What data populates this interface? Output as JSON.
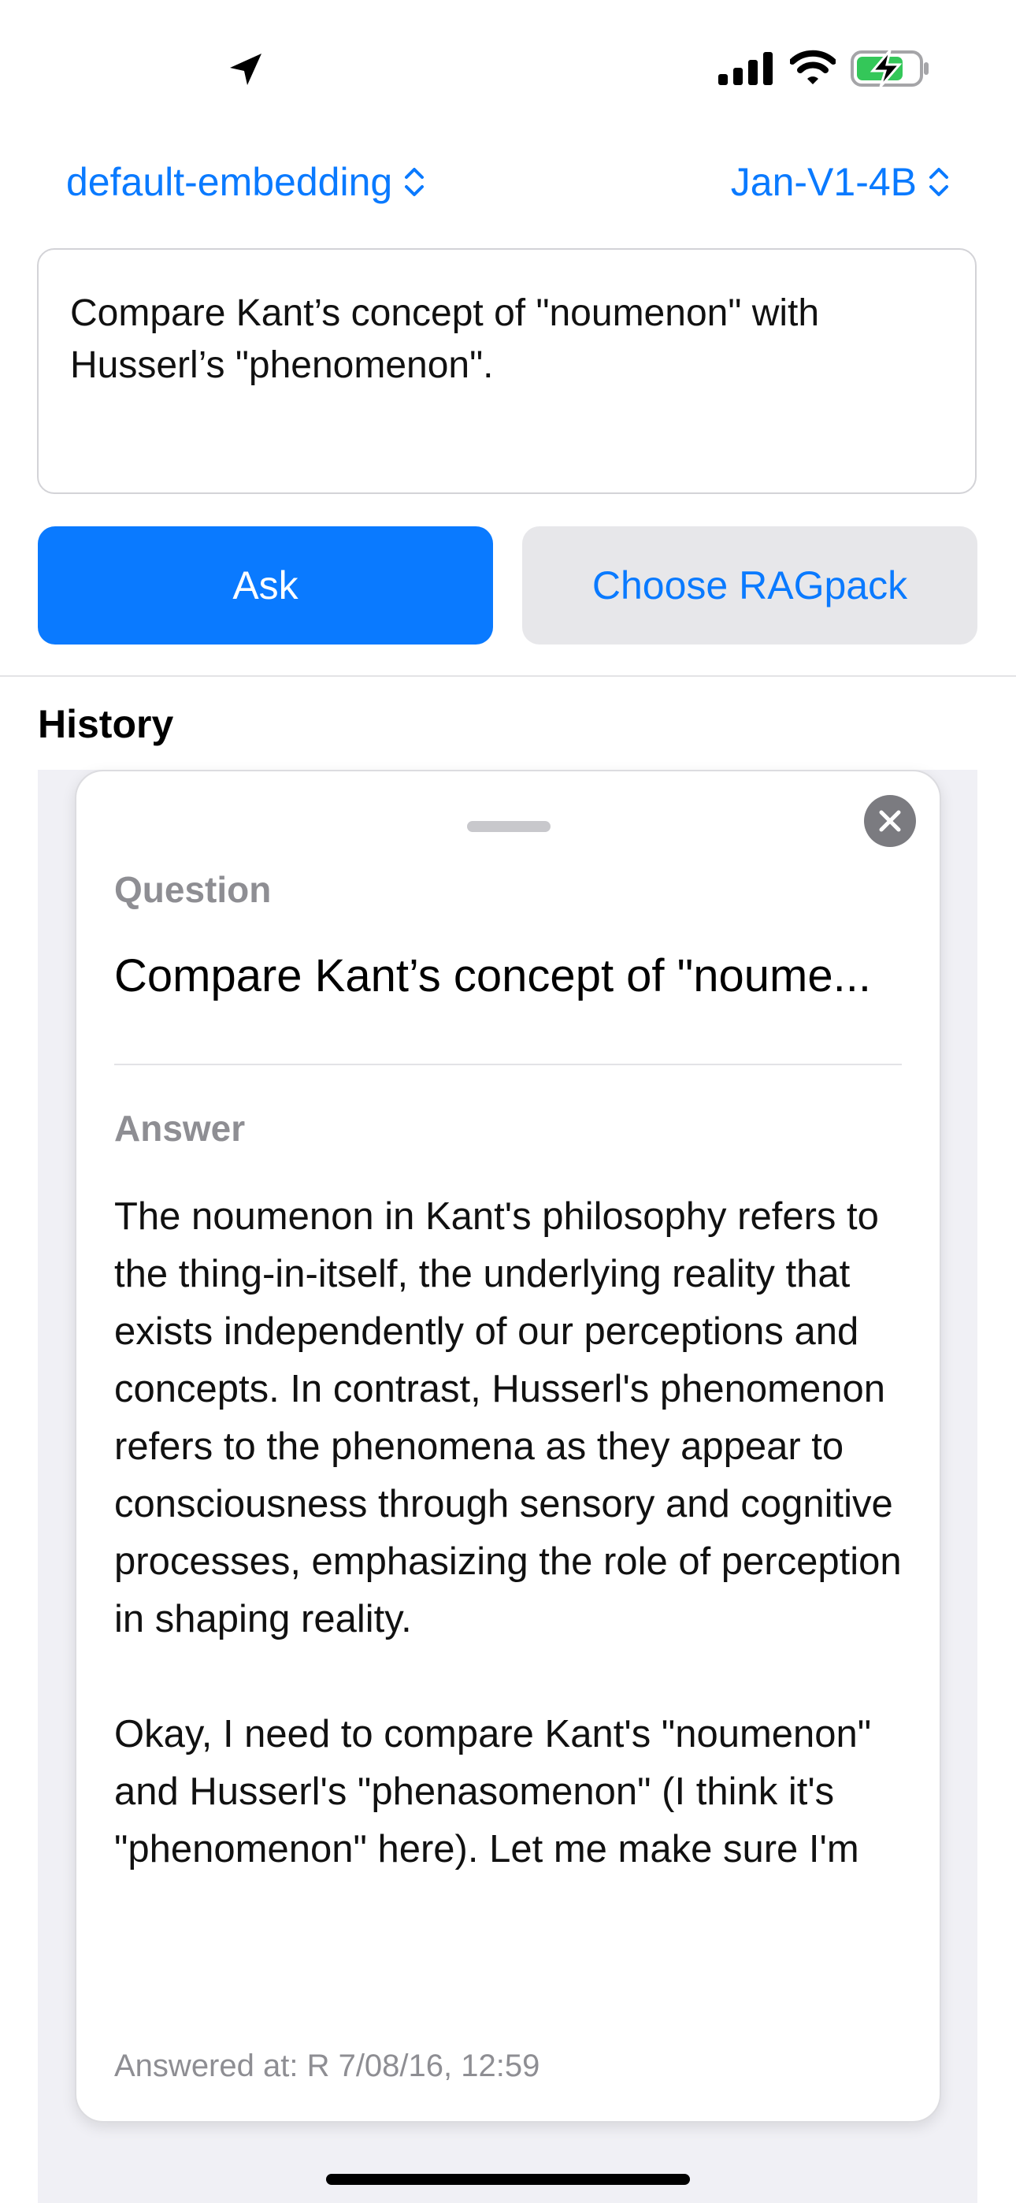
{
  "header": {
    "embedding_selector": "default-embedding",
    "model_selector": "Jan-V1-4B"
  },
  "query": {
    "text": "Compare Kant’s concept of \"noumenon\" with Husserl’s \"phenomenon\"."
  },
  "buttons": {
    "ask": "Ask",
    "choose_ragpack": "Choose RAGpack"
  },
  "history": {
    "title": "History",
    "card": {
      "question_label": "Question",
      "question_text": "Compare Kant’s concept of \"noume...",
      "answer_label": "Answer",
      "answer_paragraphs": [
        "The noumenon in Kant's philosophy refers to the thing-in-itself, the underlying reality that exists independently of our perceptions and concepts. In contrast, Husserl's phenomenon refers to the phenomena as they appear to consciousness through sensory and cognitive processes, emphasizing the role of perception in shaping reality.",
        "Okay, I need to compare Kant's \"noumenon\" and Husserl's \"phenasomenon\" (I think it's \"phenomenon\" here). Let me make sure I'm"
      ],
      "answered_at": "Answered at: R 7/08/16, 12:59"
    }
  },
  "icons": {
    "status_location": "location-arrow-icon",
    "status_signal": "cellular-signal-icon",
    "status_wifi": "wifi-icon",
    "status_battery": "battery-charging-icon",
    "selector_chevron": "chevron-up-down-icon",
    "close": "close-icon"
  },
  "colors": {
    "accent": "#0a7aff",
    "secondary_button_bg": "#e7e7ea",
    "battery_green": "#34c759",
    "label_gray": "#8e8e93"
  }
}
